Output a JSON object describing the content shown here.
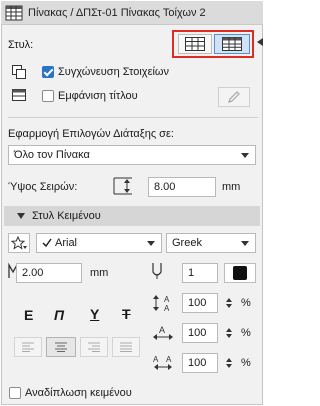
{
  "window": {
    "title": "Πίνακας / ΔΠΣτ-01 Πίνακας Τοίχων 2"
  },
  "style_row": {
    "label": "Στυλ:"
  },
  "options": {
    "merge_elements": {
      "label": "Συγχώνευση Στοιχείων",
      "checked": true
    },
    "show_title": {
      "label": "Εμφάνιση τίτλου",
      "checked": false
    }
  },
  "apply_layout": {
    "label": "Εφαρμογή Επιλογών Διάταξης σε:",
    "value": "Όλο τον Πίνακα"
  },
  "row_height": {
    "label": "Ύψος Σειρών:",
    "value": "8.00",
    "unit": "mm"
  },
  "text_style": {
    "section_label": "Στυλ Κειμένου",
    "font": "Arial",
    "script": "Greek",
    "size_value": "2.00",
    "size_unit": "mm",
    "pen_value": "1",
    "style_buttons": [
      "E",
      "Π",
      "Y",
      "T"
    ],
    "line_spacing": {
      "value": "100",
      "unit": "%"
    },
    "width_factor": {
      "value": "100",
      "unit": "%"
    },
    "letter_spacing": {
      "value": "100",
      "unit": "%"
    }
  },
  "wrap_text": {
    "label": "Αναδίπλωση κειμένου",
    "checked": false
  },
  "colors": {
    "accent": "#2b73c9",
    "highlight_frame": "#e02a26",
    "panel_bg": "#f1f1f1",
    "section_bg": "#d6d6d6"
  }
}
